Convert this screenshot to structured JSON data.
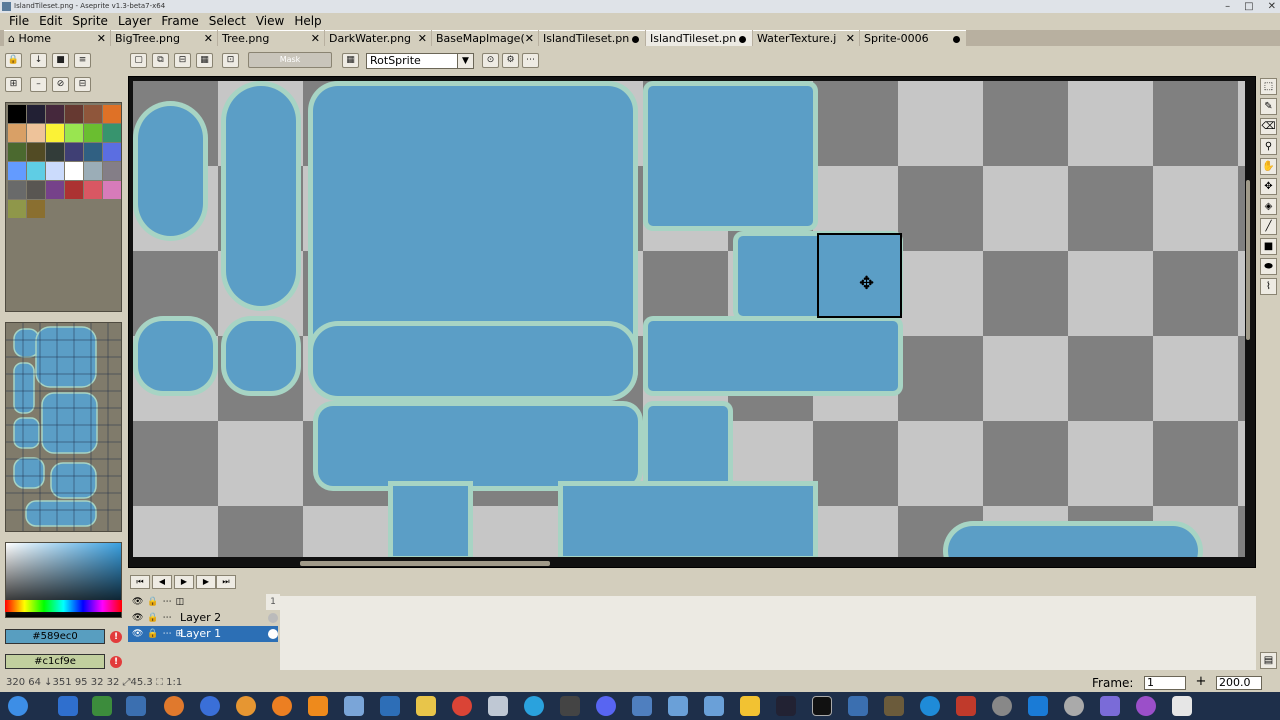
{
  "window": {
    "title": "IslandTileset.png - Aseprite v1.3-beta7-x64",
    "controls": [
      "–",
      "□",
      "✕"
    ]
  },
  "menu": [
    "File",
    "Edit",
    "Sprite",
    "Layer",
    "Frame",
    "Select",
    "View",
    "Help"
  ],
  "tabs": [
    {
      "label": "Home",
      "state": "close"
    },
    {
      "label": "BigTree.png",
      "state": "close"
    },
    {
      "label": "Tree.png",
      "state": "close"
    },
    {
      "label": "DarkWater.png",
      "state": "close"
    },
    {
      "label": "BaseMapImage(",
      "state": "close"
    },
    {
      "label": "IslandTileset.pn",
      "state": "modified"
    },
    {
      "label": "IslandTileset.pn",
      "state": "modified",
      "active": true
    },
    {
      "label": "WaterTexture.j",
      "state": "close"
    },
    {
      "label": "Sprite-0006",
      "state": "modified"
    }
  ],
  "toolbar": {
    "mask_label": "Mask",
    "rotation_algorithm": "RotSprite"
  },
  "colors": {
    "fg_hex": "#589ec0",
    "bg_hex": "#c1cf9e",
    "fg": "#589ec0",
    "bg": "#c1cf9e",
    "water": "#5b9ec6",
    "shore": "#a7d4c4"
  },
  "palette": [
    "#000000",
    "#222034",
    "#45283c",
    "#663931",
    "#8f563b",
    "#df7126",
    "#d9a066",
    "#eec39a",
    "#fbf236",
    "#99e550",
    "#6abe30",
    "#37946e",
    "#4b692f",
    "#524b24",
    "#323c39",
    "#3f3f74",
    "#306082",
    "#5b6ee1",
    "#639bff",
    "#5fcde4",
    "#cbdbfc",
    "#ffffff",
    "#9badb7",
    "#847e87",
    "#696a6a",
    "#595652",
    "#76428a",
    "#ac3232",
    "#d95763",
    "#d77bba",
    "#8f974a",
    "#8a6f30"
  ],
  "timeline": {
    "frame_header": "1",
    "layers": [
      {
        "name": "Layer 2",
        "selected": false
      },
      {
        "name": "Layer 1",
        "selected": true
      }
    ]
  },
  "status": {
    "text": "320  64  ↓351  95    32  32  ⤢45.3  ⛶ 1:1",
    "frame_label": "Frame:",
    "frame_value": "1",
    "zoom_plus": "+",
    "zoom_value": "200.0"
  }
}
